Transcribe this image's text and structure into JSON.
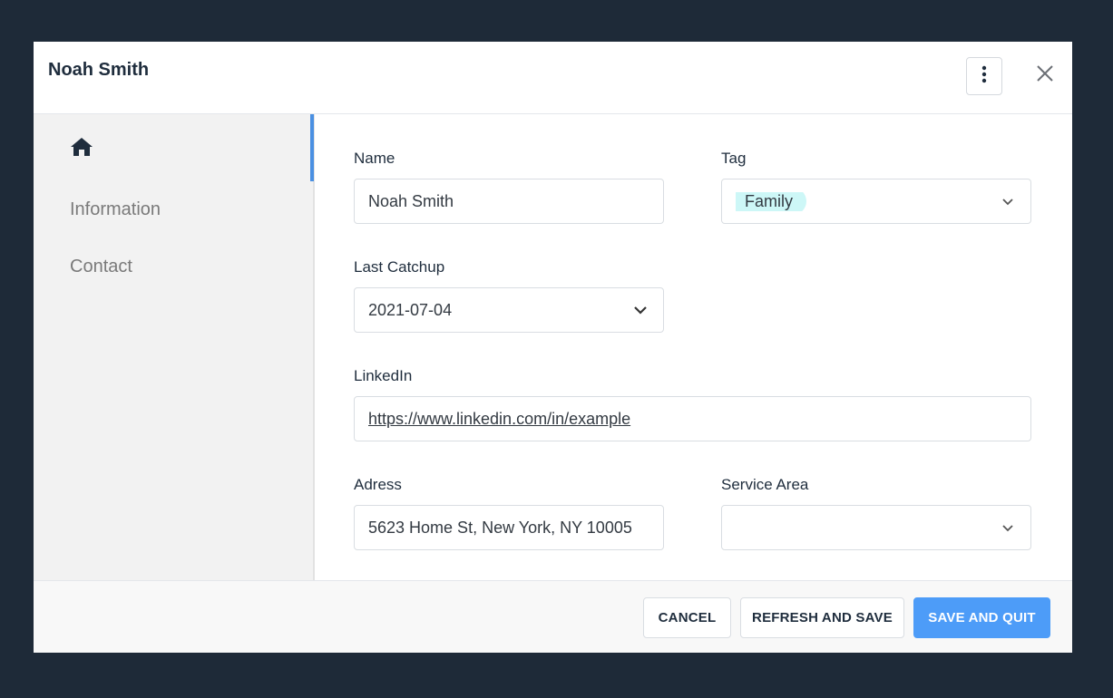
{
  "header": {
    "title": "Noah Smith"
  },
  "sidebar": {
    "items": [
      {
        "label": "Information"
      },
      {
        "label": "Contact"
      }
    ]
  },
  "form": {
    "name": {
      "label": "Name",
      "value": "Noah Smith"
    },
    "tag": {
      "label": "Tag",
      "value": "Family"
    },
    "last_catchup": {
      "label": "Last Catchup",
      "value": "2021-07-04"
    },
    "linkedin": {
      "label": "LinkedIn",
      "value": "https://www.linkedin.com/in/example"
    },
    "address": {
      "label": "Adress",
      "value": "5623 Home St, New York, NY 10005"
    },
    "service_area": {
      "label": "Service Area",
      "value": ""
    }
  },
  "footer": {
    "cancel_label": "CANCEL",
    "refresh_label": "REFRESH AND SAVE",
    "save_quit_label": "SAVE AND QUIT"
  },
  "colors": {
    "backdrop": "#1e2a38",
    "accent": "#4d9cf8",
    "tag_chip": "#cdf7f7",
    "sidebar_bg": "#f2f2f2"
  },
  "icons": {
    "menu": "kebab-vertical",
    "close": "close-x",
    "home": "home",
    "dropdown": "chevron-down"
  }
}
